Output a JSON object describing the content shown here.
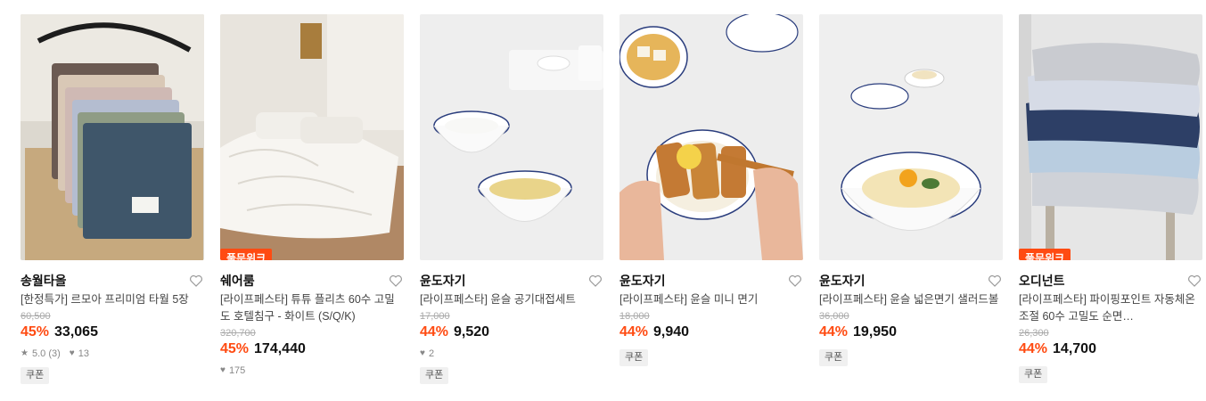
{
  "products": [
    {
      "brand": "송월타올",
      "title": "[한정특가] 르모아 프리미엄 타월 5장",
      "original_price": "60,500",
      "discount": "45%",
      "price": "33,065",
      "rating": "5.0 (3)",
      "likes": "13",
      "coupon": "쿠폰",
      "image_icon": "towel-stack-image"
    },
    {
      "brand": "쉐어룸",
      "badge": "풀문위크",
      "title": "[라이프페스타] 튜튜 플리츠 60수 고밀도 호텔침구 - 화이트 (S/Q/K)",
      "original_price": "320,700",
      "discount": "45%",
      "price": "174,440",
      "likes": "175",
      "image_icon": "bedding-room-image"
    },
    {
      "brand": "윤도자기",
      "title": "[라이프페스타] 윤슬 공기대접세트",
      "original_price": "17,000",
      "discount": "44%",
      "price": "9,520",
      "likes": "2",
      "coupon": "쿠폰",
      "image_icon": "rice-bowl-soup-image"
    },
    {
      "brand": "윤도자기",
      "title": "[라이프페스타] 윤슬 미니 면기",
      "original_price": "18,000",
      "discount": "44%",
      "price": "9,940",
      "coupon": "쿠폰",
      "image_icon": "cutlet-bowl-image"
    },
    {
      "brand": "윤도자기",
      "title": "[라이프페스타] 윤슬 넓은면기 샐러드볼",
      "original_price": "36,000",
      "discount": "44%",
      "price": "19,950",
      "coupon": "쿠폰",
      "image_icon": "noodle-bowl-image"
    },
    {
      "brand": "오디넌트",
      "badge": "풀문위크",
      "title": "[라이프페스타] 파이핑포인트 자동체온조절 60수 고밀도 순면…",
      "original_price": "26,300",
      "discount": "44%",
      "price": "14,700",
      "coupon": "쿠폰",
      "image_icon": "pillow-stack-image"
    }
  ],
  "colors": {
    "accent": "#ff4b12",
    "text": "#222222",
    "muted": "#aaaaaa"
  }
}
